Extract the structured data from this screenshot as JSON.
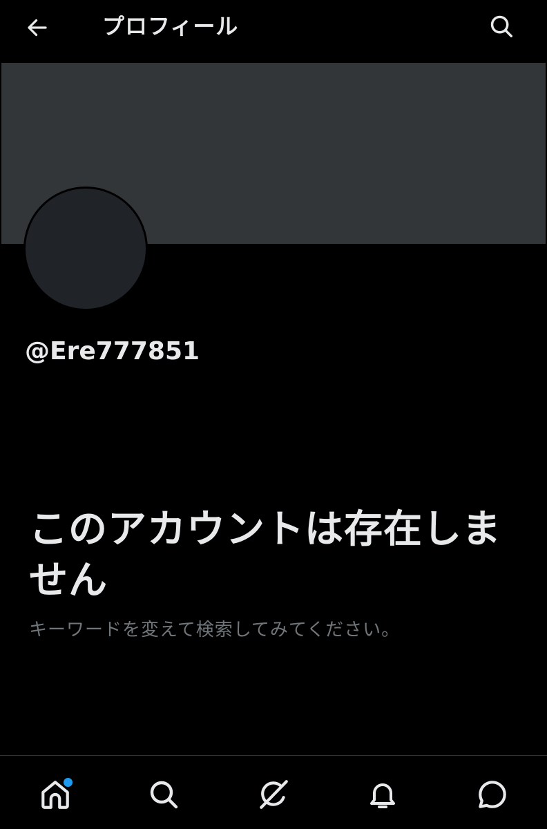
{
  "header": {
    "title": "プロフィール",
    "back_icon": "arrow-left-icon",
    "search_icon": "search-icon"
  },
  "profile": {
    "handle": "@Ere777851"
  },
  "notice": {
    "title": "このアカウントは存在しません",
    "subtitle": "キーワードを変えて検索してみてください。"
  },
  "bottom_nav": {
    "items": [
      {
        "icon": "home-icon",
        "has_notification_dot": true
      },
      {
        "icon": "search-icon"
      },
      {
        "icon": "grok-icon"
      },
      {
        "icon": "bell-icon"
      },
      {
        "icon": "messages-icon"
      }
    ]
  },
  "colors": {
    "background": "#000000",
    "banner": "#333639",
    "avatar": "#202327",
    "text_primary": "#e7e9ea",
    "text_secondary": "#71767b",
    "accent_dot": "#1d9bf0",
    "divider": "#2f3336"
  }
}
